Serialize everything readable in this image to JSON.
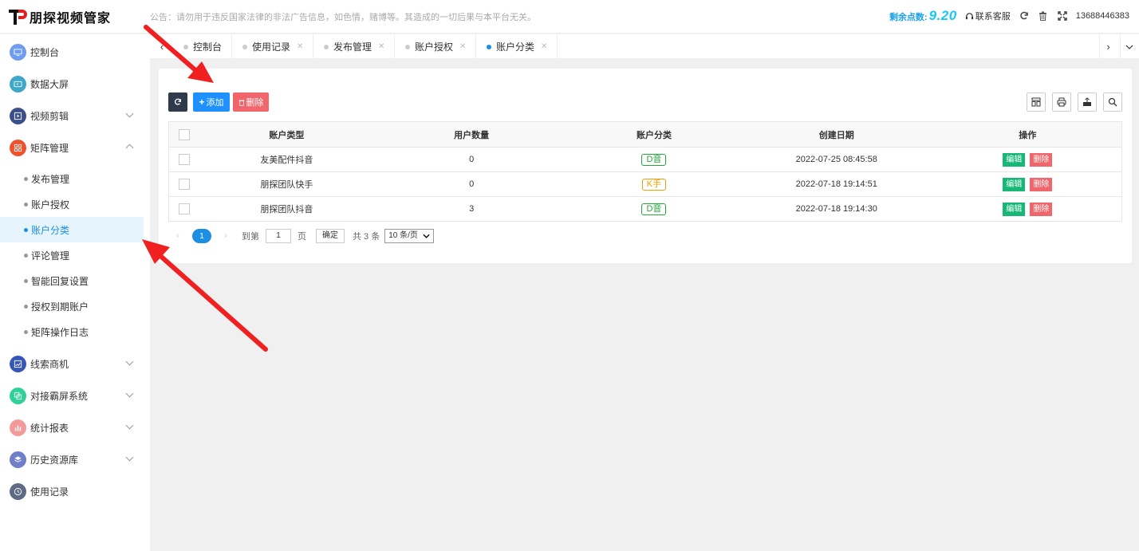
{
  "header": {
    "logo_text": "朋探视频管家",
    "notice": "公告：请勿用于违反国家法律的非法广告信息，如色情，赌博等。其造成的一切后果与本平台无关。",
    "points_label": "剩余点数:",
    "points_value": "9.20",
    "contact_label": "联系客服",
    "user": "13688446383"
  },
  "sidebar": {
    "items": [
      {
        "label": "控制台",
        "icon": "monitor-icon",
        "color": "#6e9cf0"
      },
      {
        "label": "数据大屏",
        "icon": "screen-icon",
        "color": "#3fa7c7"
      },
      {
        "label": "视频剪辑",
        "icon": "video-edit-icon",
        "color": "#3b4f8a"
      },
      {
        "label": "矩阵管理",
        "icon": "matrix-icon",
        "color": "#f0522d"
      },
      {
        "label": "线索商机",
        "icon": "chart-icon",
        "color": "#3657b8"
      },
      {
        "label": "对接霸屏系统",
        "icon": "copy-icon",
        "color": "#2fd19b"
      },
      {
        "label": "统计报表",
        "icon": "bar-chart-icon",
        "color": "#f29a9a"
      },
      {
        "label": "历史资源库",
        "icon": "layers-icon",
        "color": "#6f7fc9"
      },
      {
        "label": "使用记录",
        "icon": "clock-icon",
        "color": "#5d6b85"
      }
    ],
    "submenu": [
      {
        "label": "发布管理"
      },
      {
        "label": "账户授权"
      },
      {
        "label": "账户分类"
      },
      {
        "label": "评论管理"
      },
      {
        "label": "智能回复设置"
      },
      {
        "label": "授权到期账户"
      },
      {
        "label": "矩阵操作日志"
      }
    ]
  },
  "tabs": [
    {
      "label": "控制台"
    },
    {
      "label": "使用记录"
    },
    {
      "label": "发布管理"
    },
    {
      "label": "账户授权"
    },
    {
      "label": "账户分类"
    }
  ],
  "toolbar": {
    "add_label": "添加",
    "delete_label": "删除"
  },
  "table": {
    "headers": [
      "账户类型",
      "用户数量",
      "账户分类",
      "创建日期",
      "操作"
    ],
    "rows": [
      {
        "type": "友美配件抖音",
        "count": "0",
        "category": "D音",
        "date": "2022-07-25 08:45:58"
      },
      {
        "type": "朋探团队快手",
        "count": "0",
        "category": "K手",
        "date": "2022-07-18 19:14:51"
      },
      {
        "type": "朋探团队抖音",
        "count": "3",
        "category": "D音",
        "date": "2022-07-18 19:14:30"
      }
    ],
    "edit_label": "编辑",
    "delete_label": "删除"
  },
  "pager": {
    "current": "1",
    "goto_label": "到第",
    "page_value": "1",
    "page_unit": "页",
    "confirm": "确定",
    "total": "共 3 条",
    "page_size": "10 条/页"
  }
}
